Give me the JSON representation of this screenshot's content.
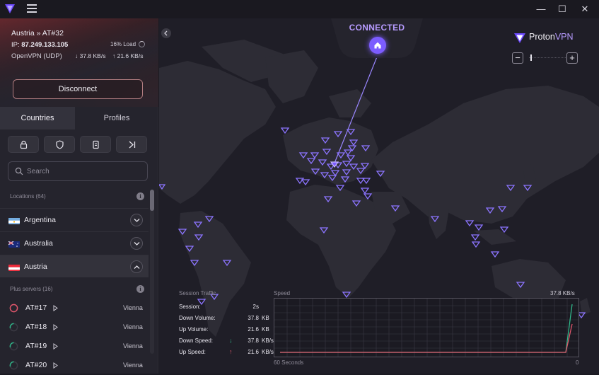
{
  "titlebar": {
    "minimize": "—",
    "maximize": "☐",
    "close": "✕"
  },
  "connection": {
    "server": "Austria » AT#32",
    "ip_label": "IP:",
    "ip": "87.249.133.105",
    "load": "16% Load",
    "protocol": "OpenVPN (UDP)",
    "down_rate": "↓ 37.8 KB/s",
    "up_rate": "↑ 21.6 KB/s",
    "disconnect_label": "Disconnect"
  },
  "tabs": {
    "countries": "Countries",
    "profiles": "Profiles"
  },
  "filters": [
    "secure-core-filter-icon",
    "netshield-filter-icon",
    "p2p-filter-icon",
    "tor-filter-icon"
  ],
  "search": {
    "placeholder": "Search"
  },
  "locations": {
    "label": "Locations (64)",
    "countries": [
      {
        "name": "Argentina",
        "expanded": false
      },
      {
        "name": "Australia",
        "expanded": false
      },
      {
        "name": "Austria",
        "expanded": true
      }
    ],
    "plus_label": "Plus servers (16)",
    "servers": [
      {
        "name": "AT#17",
        "city": "Vienna",
        "load": 0.0,
        "color": "#e0566b"
      },
      {
        "name": "AT#18",
        "city": "Vienna",
        "load": 0.2,
        "color": "#2fb789"
      },
      {
        "name": "AT#19",
        "city": "Vienna",
        "load": 0.2,
        "color": "#2fb789"
      },
      {
        "name": "AT#20",
        "city": "Vienna",
        "load": 0.2,
        "color": "#2fb789"
      }
    ]
  },
  "map": {
    "status": "CONNECTED",
    "brand_a": "Proton",
    "brand_b": "VPN",
    "zoom_in": "+",
    "zoom_out": "−",
    "accent": "#7c5cff"
  },
  "traffic": {
    "title": "Session Traffic",
    "rows": [
      {
        "label": "Session:",
        "value": "2s",
        "unit": ""
      },
      {
        "label": "Down Volume:",
        "value": "37.8",
        "unit": "KB"
      },
      {
        "label": "Up Volume:",
        "value": "21.6",
        "unit": "KB"
      },
      {
        "label": "Down Speed:",
        "value": "37.8",
        "unit": "KB/s",
        "arrow": "↓"
      },
      {
        "label": "Up Speed:",
        "value": "21.6",
        "unit": "KB/s",
        "arrow": "↑"
      }
    ],
    "speed_label": "Speed",
    "speed_max": "37.8  KB/s",
    "axis_left": "60 Seconds",
    "axis_right": "0"
  }
}
